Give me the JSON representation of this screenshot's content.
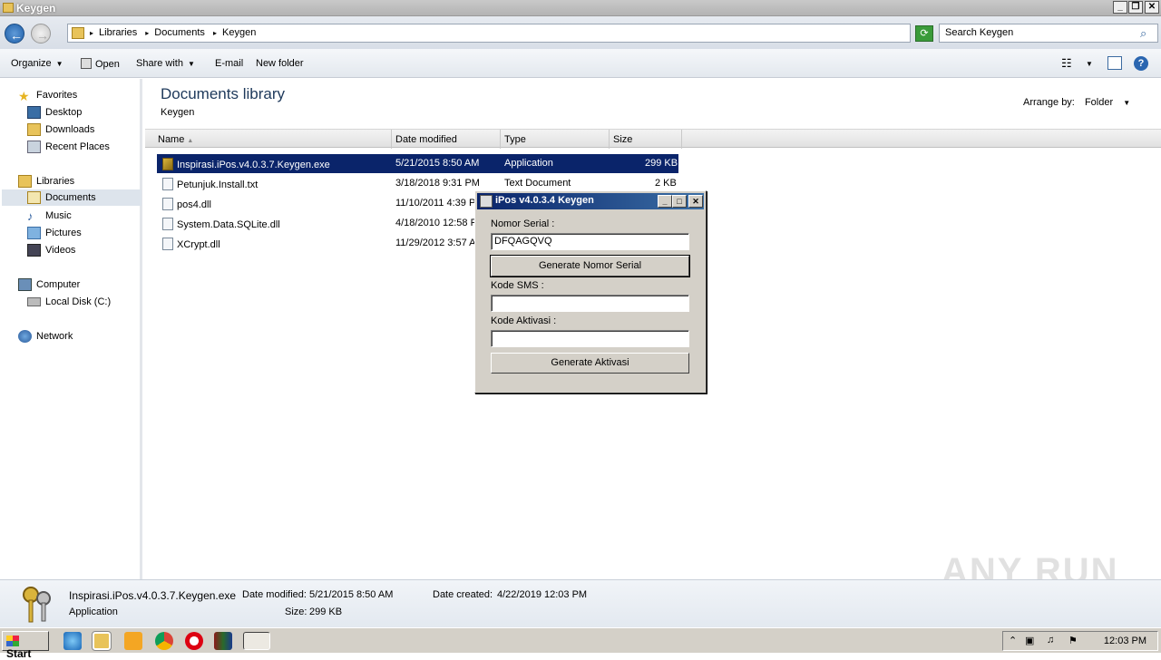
{
  "window": {
    "title": "Keygen"
  },
  "address": {
    "crumbs": [
      "Libraries",
      "Documents",
      "Keygen"
    ]
  },
  "search": {
    "placeholder": "Search Keygen"
  },
  "toolbar": {
    "organize": "Organize",
    "open": "Open",
    "share_with": "Share with",
    "email": "E-mail",
    "new_folder": "New folder"
  },
  "sidebar": {
    "favorites": "Favorites",
    "fav_items": [
      "Desktop",
      "Downloads",
      "Recent Places"
    ],
    "libraries": "Libraries",
    "lib_items": [
      "Documents",
      "Music",
      "Pictures",
      "Videos"
    ],
    "computer": "Computer",
    "comp_items": [
      "Local Disk (C:)"
    ],
    "network": "Network"
  },
  "main": {
    "title": "Documents library",
    "subtitle": "Keygen",
    "arrange_label": "Arrange by:",
    "arrange_value": "Folder",
    "columns": [
      "Name",
      "Date modified",
      "Type",
      "Size"
    ],
    "files": [
      {
        "name": "Inspirasi.iPos.v4.0.3.7.Keygen.exe",
        "date": "5/21/2015 8:50 AM",
        "type": "Application",
        "size": "299 KB"
      },
      {
        "name": "Petunjuk.Install.txt",
        "date": "3/18/2018 9:31 PM",
        "type": "Text Document",
        "size": "2 KB"
      },
      {
        "name": "pos4.dll",
        "date": "11/10/2011 4:39 P",
        "type": "",
        "size": ""
      },
      {
        "name": "System.Data.SQLite.dll",
        "date": "4/18/2010 12:58 P",
        "type": "",
        "size": ""
      },
      {
        "name": "XCrypt.dll",
        "date": "11/29/2012 3:57 A",
        "type": "",
        "size": ""
      }
    ]
  },
  "details": {
    "filename": "Inspirasi.iPos.v4.0.3.7.Keygen.exe",
    "type": "Application",
    "date_modified_label": "Date modified:",
    "date_modified": "5/21/2015 8:50 AM",
    "date_created_label": "Date created:",
    "date_created": "4/22/2019 12:03 PM",
    "size_label": "Size:",
    "size": "299 KB"
  },
  "dialog": {
    "title": "iPos v4.0.3.4 Keygen",
    "serial_label": "Nomor Serial :",
    "serial_value": "DFQAGQVQ",
    "generate_serial": "Generate Nomor Serial",
    "sms_label": "Kode SMS :",
    "sms_value": "",
    "activation_label": "Kode Aktivasi :",
    "activation_value": "",
    "generate_activation": "Generate Aktivasi"
  },
  "taskbar": {
    "start": "Start",
    "clock": "12:03 PM"
  },
  "watermark": "ANY RUN"
}
